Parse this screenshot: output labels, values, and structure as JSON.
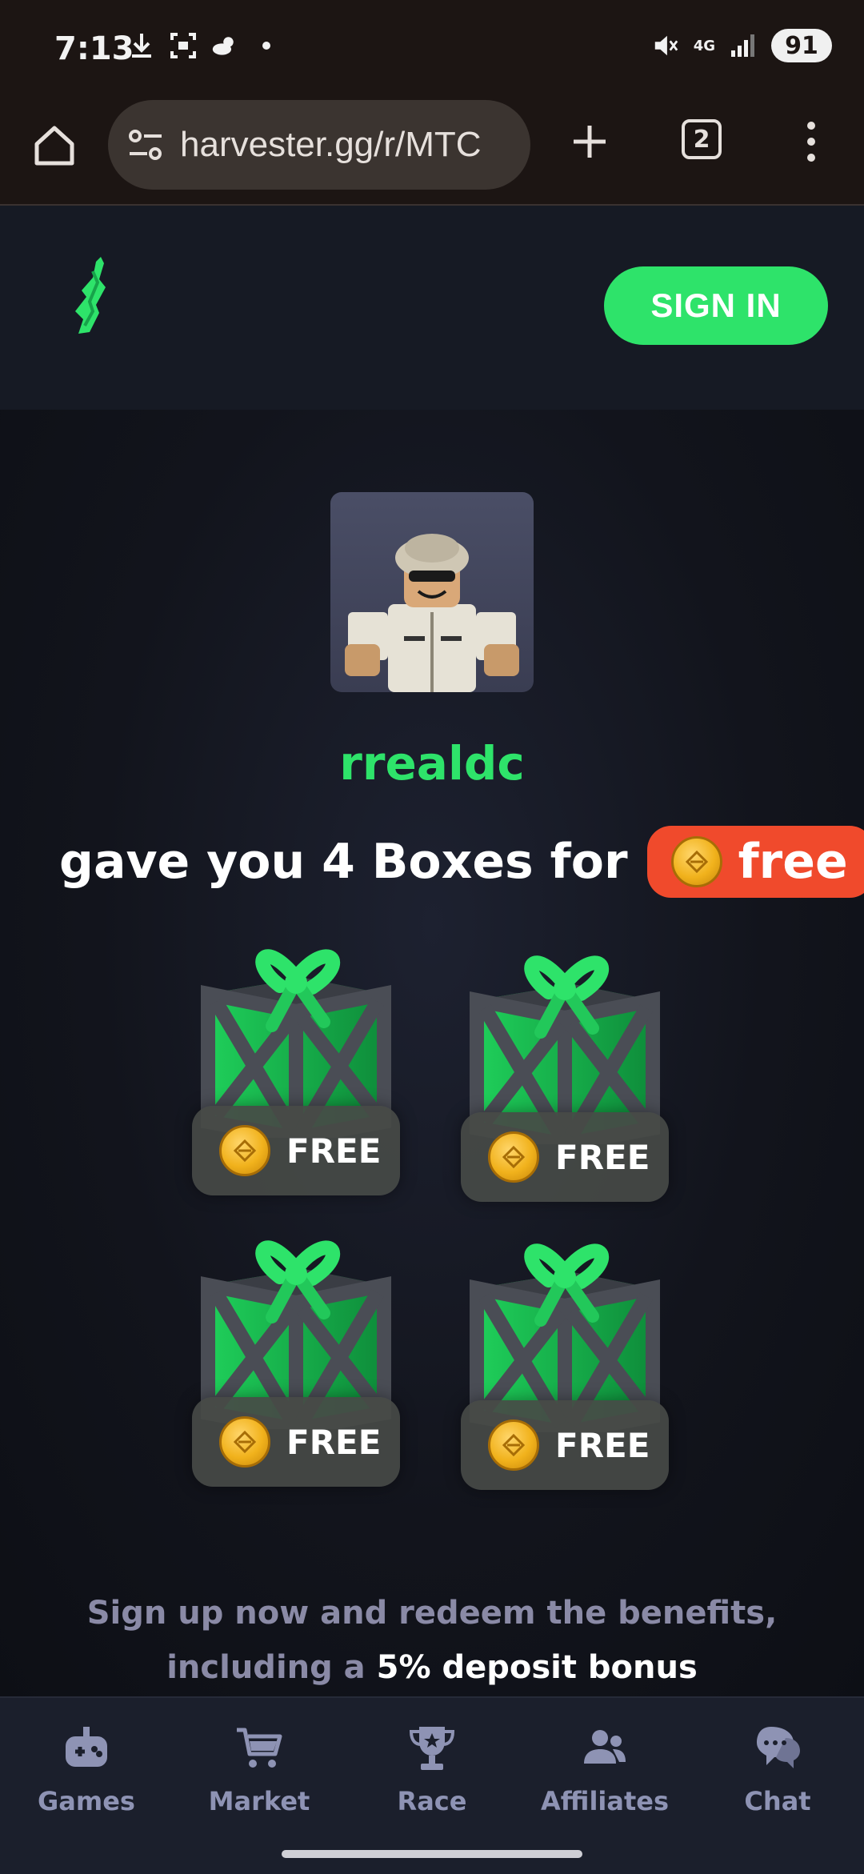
{
  "status_bar": {
    "time": "7:13",
    "network": "4G",
    "battery": "91",
    "icons": [
      "download-icon",
      "screenshot-icon",
      "weather-icon",
      "dot-icon",
      "mute-icon",
      "signal-icon"
    ]
  },
  "browser": {
    "url": "harvester.gg/r/MTC",
    "tab_count": "2"
  },
  "header": {
    "signin_label": "SIGN IN"
  },
  "referral": {
    "username": "rrealdc",
    "gave_text": "gave you 4 Boxes for",
    "free_label": "free"
  },
  "boxes": [
    {
      "badge": "FREE"
    },
    {
      "badge": "FREE"
    },
    {
      "badge": "FREE"
    },
    {
      "badge": "FREE"
    }
  ],
  "promo": {
    "text_before": "Sign up now and redeem the benefits, including a ",
    "highlight": "5% deposit bonus"
  },
  "nav": {
    "items": [
      {
        "label": "Games",
        "icon": "gamepad-icon"
      },
      {
        "label": "Market",
        "icon": "cart-icon"
      },
      {
        "label": "Race",
        "icon": "trophy-icon"
      },
      {
        "label": "Affiliates",
        "icon": "users-icon"
      },
      {
        "label": "Chat",
        "icon": "chat-icon"
      }
    ]
  },
  "colors": {
    "accent_green": "#2ee36a",
    "free_pill": "#f04a2c",
    "nav_label": "#8e93b4",
    "promo_text": "#8a8aa6"
  }
}
